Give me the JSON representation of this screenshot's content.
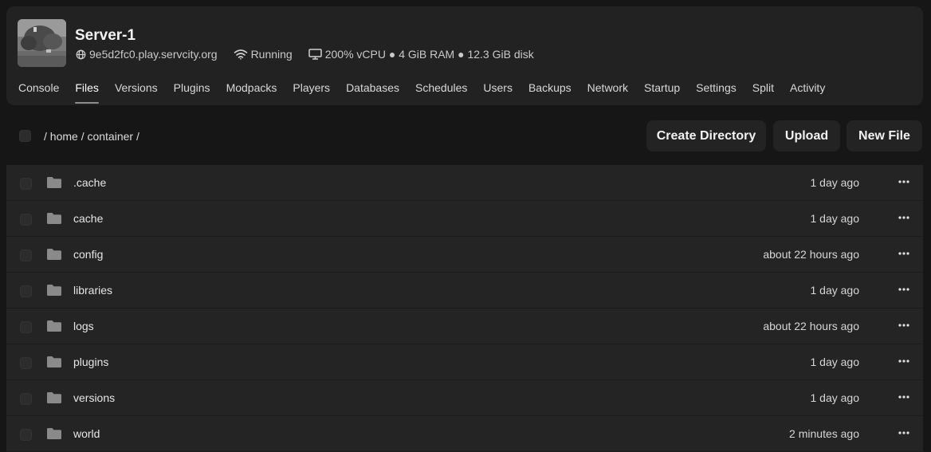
{
  "server": {
    "name": "Server-1",
    "address": "9e5d2fc0.play.servcity.org",
    "status": "Running",
    "resources": "200% vCPU ● 4 GiB RAM ● 12.3 GiB disk"
  },
  "tabs": [
    {
      "label": "Console"
    },
    {
      "label": "Files",
      "active": true
    },
    {
      "label": "Versions"
    },
    {
      "label": "Plugins"
    },
    {
      "label": "Modpacks"
    },
    {
      "label": "Players"
    },
    {
      "label": "Databases"
    },
    {
      "label": "Schedules"
    },
    {
      "label": "Users"
    },
    {
      "label": "Backups"
    },
    {
      "label": "Network"
    },
    {
      "label": "Startup"
    },
    {
      "label": "Settings"
    },
    {
      "label": "Split"
    },
    {
      "label": "Activity"
    }
  ],
  "toolbar": {
    "breadcrumb": "/ home / container /",
    "create_directory_label": "Create Directory",
    "upload_label": "Upload",
    "new_file_label": "New File"
  },
  "files": [
    {
      "name": ".cache",
      "modified": "1 day ago"
    },
    {
      "name": "cache",
      "modified": "1 day ago"
    },
    {
      "name": "config",
      "modified": "about 22 hours ago"
    },
    {
      "name": "libraries",
      "modified": "1 day ago"
    },
    {
      "name": "logs",
      "modified": "about 22 hours ago"
    },
    {
      "name": "plugins",
      "modified": "1 day ago"
    },
    {
      "name": "versions",
      "modified": "1 day ago"
    },
    {
      "name": "world",
      "modified": "2 minutes ago"
    }
  ],
  "icons": {
    "address": "globe-icon",
    "status": "wifi-icon",
    "resources": "monitor-icon",
    "folder": "folder-icon",
    "actions": "more-horizontal-icon"
  }
}
